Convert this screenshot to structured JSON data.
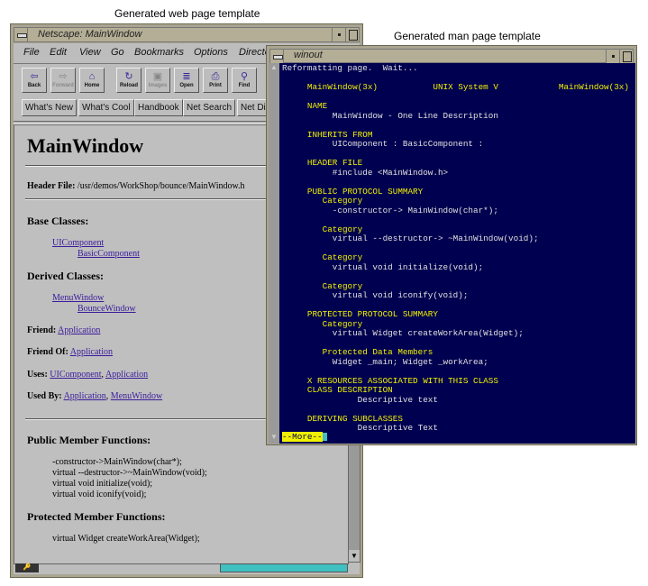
{
  "captions": {
    "web": "Generated web page template",
    "man": "Generated man page template"
  },
  "netscape": {
    "title": "Netscape: MainWindow",
    "menu": [
      "File",
      "Edit",
      "View",
      "Go",
      "Bookmarks",
      "Options",
      "Directory"
    ],
    "toolbar": [
      {
        "label": "Back",
        "icon": "back-arrow-icon",
        "glyph": "⇦",
        "enabled": true
      },
      {
        "label": "Forward",
        "icon": "forward-arrow-icon",
        "glyph": "⇨",
        "enabled": false
      },
      {
        "label": "Home",
        "icon": "home-icon",
        "glyph": "⌂",
        "enabled": true
      },
      {
        "label": "Reload",
        "icon": "reload-icon",
        "glyph": "↻",
        "enabled": true
      },
      {
        "label": "Images",
        "icon": "images-icon",
        "glyph": "▣",
        "enabled": false
      },
      {
        "label": "Open",
        "icon": "open-icon",
        "glyph": "≣",
        "enabled": true
      },
      {
        "label": "Print",
        "icon": "print-icon",
        "glyph": "⎙",
        "enabled": true
      },
      {
        "label": "Find",
        "icon": "find-icon",
        "glyph": "⚲",
        "enabled": true
      }
    ],
    "directory_buttons": [
      "What's New",
      "What's Cool",
      "Handbook",
      "Net Search",
      "Net Directory"
    ],
    "page": {
      "heading": "MainWindow",
      "header_file_label": "Header File:",
      "header_file_path": "/usr/demos/WorkShop/bounce/MainWindow.h",
      "base_classes_label": "Base Classes:",
      "base_classes": [
        "UIComponent",
        "BasicComponent"
      ],
      "derived_classes_label": "Derived Classes:",
      "derived_classes": [
        "MenuWindow",
        "BounceWindow"
      ],
      "friend_label": "Friend:",
      "friend": "Application",
      "friend_of_label": "Friend Of:",
      "friend_of": "Application",
      "uses_label": "Uses:",
      "uses": [
        "UIComponent",
        "Application"
      ],
      "used_by_label": "Used By:",
      "used_by": [
        "Application",
        "MenuWindow"
      ],
      "public_label": "Public Member Functions:",
      "public_functions": [
        "-constructor->MainWindow(char*);",
        "virtual --destructor->~MainWindow(void);",
        "virtual void initialize(void);",
        "virtual void iconify(void);"
      ],
      "protected_label": "Protected Member Functions:",
      "protected_functions": [
        "virtual Widget createWorkArea(Widget);"
      ]
    },
    "colors": {
      "link": "#3a1b9c",
      "progress": "#40c0c0"
    }
  },
  "winout": {
    "title": "winout",
    "lines": [
      {
        "row": 0,
        "type": "b",
        "text": "Reformatting page.  Wait..."
      },
      {
        "row": 2,
        "type": "h",
        "text": "     MainWindow(3x)           UNIX System V            MainWindow(3x)"
      },
      {
        "row": 4,
        "type": "h",
        "text": "     NAME"
      },
      {
        "row": 5,
        "type": "b",
        "text": "          MainWindow - One Line Description"
      },
      {
        "row": 7,
        "type": "h",
        "text": "     INHERITS FROM"
      },
      {
        "row": 8,
        "type": "b",
        "text": "          UIComponent : BasicComponent :"
      },
      {
        "row": 10,
        "type": "h",
        "text": "     HEADER FILE"
      },
      {
        "row": 11,
        "type": "b",
        "text": "          #include <MainWindow.h>"
      },
      {
        "row": 13,
        "type": "h",
        "text": "     PUBLIC PROTOCOL SUMMARY"
      },
      {
        "row": 14,
        "type": "h",
        "text": "        Category"
      },
      {
        "row": 15,
        "type": "b",
        "text": "          -constructor-> MainWindow(char*);"
      },
      {
        "row": 17,
        "type": "h",
        "text": "        Category"
      },
      {
        "row": 18,
        "type": "b",
        "text": "          virtual --destructor-> ~MainWindow(void);"
      },
      {
        "row": 20,
        "type": "h",
        "text": "        Category"
      },
      {
        "row": 21,
        "type": "b",
        "text": "          virtual void initialize(void);"
      },
      {
        "row": 23,
        "type": "h",
        "text": "        Category"
      },
      {
        "row": 24,
        "type": "b",
        "text": "          virtual void iconify(void);"
      },
      {
        "row": 26,
        "type": "h",
        "text": "     PROTECTED PROTOCOL SUMMARY"
      },
      {
        "row": 27,
        "type": "h",
        "text": "        Category"
      },
      {
        "row": 28,
        "type": "b",
        "text": "          virtual Widget createWorkArea(Widget);"
      },
      {
        "row": 30,
        "type": "h",
        "text": "        Protected Data Members"
      },
      {
        "row": 31,
        "type": "b",
        "text": "          Widget _main; Widget _workArea;"
      },
      {
        "row": 33,
        "type": "h",
        "text": "     X RESOURCES ASSOCIATED WITH THIS CLASS"
      },
      {
        "row": 34,
        "type": "h",
        "text": "     CLASS DESCRIPTION"
      },
      {
        "row": 35,
        "type": "b",
        "text": "               Descriptive text"
      },
      {
        "row": 37,
        "type": "h",
        "text": "     DERIVING SUBCLASSES"
      },
      {
        "row": 38,
        "type": "b",
        "text": "               Descriptive Text"
      }
    ],
    "more_prompt": "--More--",
    "colors": {
      "background": "#000050",
      "heading": "#f0f000",
      "body": "#e0e0e0"
    }
  }
}
